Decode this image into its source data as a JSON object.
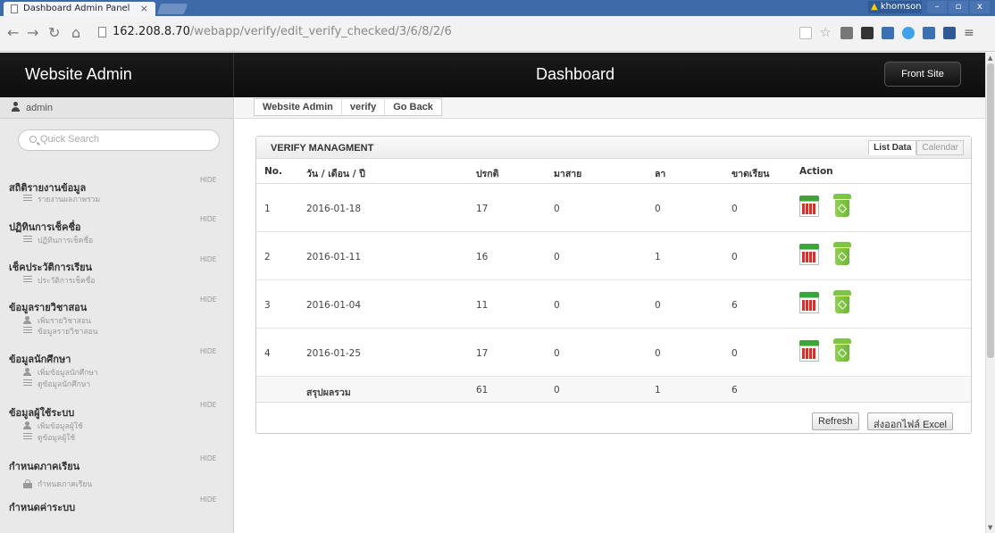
{
  "browser": {
    "tab_title": "Dashboard Admin Panel",
    "tab_close": "×",
    "url_host": "162.208.8.70",
    "url_path": "/webapp/verify/edit_verify_checked/3/6/8/2/6",
    "window_user": "khomson",
    "window_buttons": [
      "–",
      "▫",
      "x"
    ]
  },
  "header": {
    "brand": "Website Admin",
    "title": "Dashboard",
    "front_site": "Front Site"
  },
  "sidebar": {
    "user": "admin",
    "search_placeholder": "Quick Search",
    "hide_label": "HIDE",
    "sections": [
      {
        "title": "สถิติรายงานข้อมูล",
        "items": [
          {
            "icon": "list-icon",
            "label": "รายงานผลภาพรวม"
          }
        ]
      },
      {
        "title": "ปฏิทินการเช็คชื่อ",
        "items": [
          {
            "icon": "list-icon",
            "label": "ปฏิทินการเช็คชื่อ"
          }
        ]
      },
      {
        "title": "เช็คประวัติการเรียน",
        "items": [
          {
            "icon": "list-icon",
            "label": "ประวัติการเช็คชื่อ"
          }
        ]
      },
      {
        "title": "ข้อมูลรายวิชาสอน",
        "items": [
          {
            "icon": "add-user-icon",
            "label": "เพิ่มรายวิชาสอน"
          },
          {
            "icon": "list-icon",
            "label": "ข้อมูลรายวิชาสอน"
          }
        ]
      },
      {
        "title": "ข้อมูลนักศึกษา",
        "items": [
          {
            "icon": "add-user-icon",
            "label": "เพิ่มข้อมูลนักศึกษา"
          },
          {
            "icon": "list-icon",
            "label": "ดูข้อมูลนักศึกษา"
          }
        ]
      },
      {
        "title": "ข้อมูลผู้ใช้ระบบ",
        "items": [
          {
            "icon": "add-user-icon",
            "label": "เพิ่มข้อมูลผู้ใช้"
          },
          {
            "icon": "list-icon",
            "label": "ดูข้อมูลผู้ใช้"
          }
        ]
      },
      {
        "title": "กำหนดภาคเรียน",
        "items": [
          {
            "icon": "lock-icon",
            "label": "กำหนดภาคเรียน"
          }
        ]
      },
      {
        "title": "กำหนดค่าระบบ",
        "items": []
      }
    ]
  },
  "breadcrumb": [
    "Website Admin",
    "verify",
    "Go Back"
  ],
  "panel": {
    "title": "VERIFY MANAGMENT",
    "tabs": [
      "List Data",
      "Calendar"
    ],
    "columns": [
      "No.",
      "วัน / เดือน / ปี",
      "ปรกติ",
      "มาสาย",
      "ลา",
      "ขาดเรียน",
      "Action"
    ],
    "rows": [
      {
        "no": "1",
        "date": "2016-01-18",
        "present": "17",
        "late": "0",
        "leave": "0",
        "absent": "0"
      },
      {
        "no": "2",
        "date": "2016-01-11",
        "present": "16",
        "late": "0",
        "leave": "1",
        "absent": "0"
      },
      {
        "no": "3",
        "date": "2016-01-04",
        "present": "11",
        "late": "0",
        "leave": "0",
        "absent": "6"
      },
      {
        "no": "4",
        "date": "2016-01-25",
        "present": "17",
        "late": "0",
        "leave": "0",
        "absent": "0"
      }
    ],
    "summary": {
      "label": "สรุปผลรวม",
      "present": "61",
      "late": "0",
      "leave": "1",
      "absent": "6"
    },
    "refresh": "Refresh",
    "export": "ส่งออกไฟล์ Excel"
  },
  "colors": {
    "header_bg": "#111111",
    "sidebar_bg": "#e9e9e9",
    "tab_strip": "#3f6aa9"
  }
}
